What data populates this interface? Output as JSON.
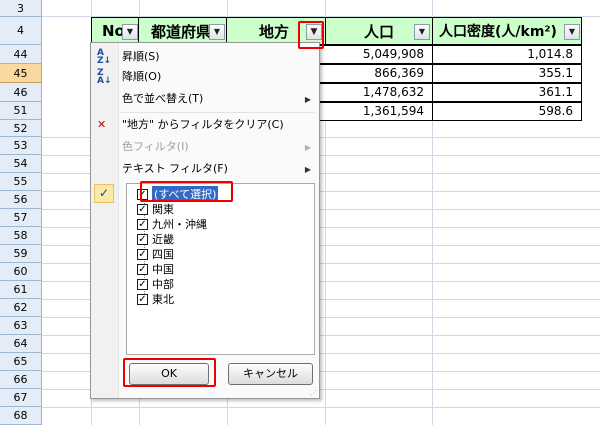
{
  "row_numbers": [
    "3",
    "4",
    "44",
    "45",
    "46",
    "51",
    "52",
    "53",
    "54",
    "55",
    "56",
    "57",
    "58",
    "59",
    "60",
    "61",
    "62",
    "63",
    "64",
    "65",
    "66",
    "67",
    "68"
  ],
  "headers": {
    "no": "No",
    "pref": "都道府県",
    "region": "地方",
    "population": "人口",
    "density": "人口密度(人/km²)"
  },
  "rows": [
    {
      "population": "5,049,908",
      "density": "1,014.8"
    },
    {
      "population": "866,369",
      "density": "355.1"
    },
    {
      "population": "1,478,632",
      "density": "361.1"
    },
    {
      "population": "1,361,594",
      "density": "598.6"
    }
  ],
  "menu": {
    "sort_asc": "昇順(S)",
    "sort_desc": "降順(O)",
    "sort_by_color": "色で並べ替え(T)",
    "clear_filter": "\"地方\" からフィルタをクリア(C)",
    "color_filter": "色フィルタ(I)",
    "text_filter": "テキスト フィルタ(F)"
  },
  "filter_items": [
    {
      "label": "(すべて選択)",
      "checked": true
    },
    {
      "label": "関東",
      "checked": true
    },
    {
      "label": "九州・沖縄",
      "checked": true
    },
    {
      "label": "近畿",
      "checked": true
    },
    {
      "label": "四国",
      "checked": true
    },
    {
      "label": "中国",
      "checked": true
    },
    {
      "label": "中部",
      "checked": true
    },
    {
      "label": "東北",
      "checked": true
    }
  ],
  "buttons": {
    "ok": "OK",
    "cancel": "キャンセル"
  },
  "colors": {
    "header_fill": "#ccffcc",
    "highlight": "#ee0000",
    "selected_row_header": "#f9d99f"
  }
}
